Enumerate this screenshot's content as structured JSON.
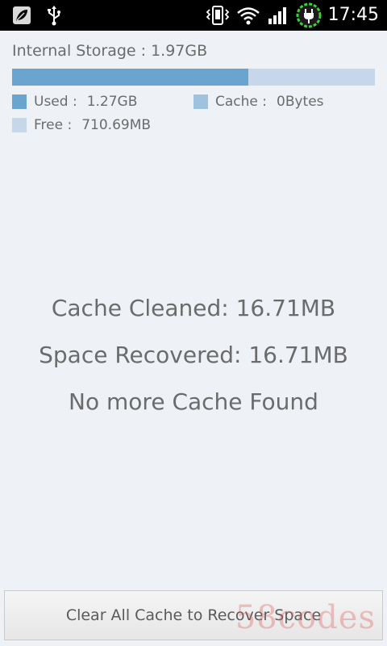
{
  "status_bar": {
    "time": "17:45",
    "icons": [
      "leaf-notification-icon",
      "usb-icon",
      "vibrate-icon",
      "wifi-icon",
      "signal-icon",
      "battery-charging-icon"
    ]
  },
  "storage": {
    "title": "Internal Storage : 1.97GB",
    "used_fraction": 0.65,
    "legend": {
      "used_label": "Used :",
      "used_value": "1.27GB",
      "cache_label": "Cache :",
      "cache_value": "0Bytes",
      "free_label": "Free :",
      "free_value": "710.69MB"
    },
    "colors": {
      "used": "#6aa5cf",
      "cache": "#9fc3de",
      "free": "#c5d7e8"
    }
  },
  "messages": {
    "cache_cleaned": "Cache Cleaned: 16.71MB",
    "space_recovered": "Space Recovered: 16.71MB",
    "no_more_cache": "No more Cache Found"
  },
  "actions": {
    "clear_button_label": "Clear All Cache to Recover Space"
  },
  "watermark": "58codes"
}
